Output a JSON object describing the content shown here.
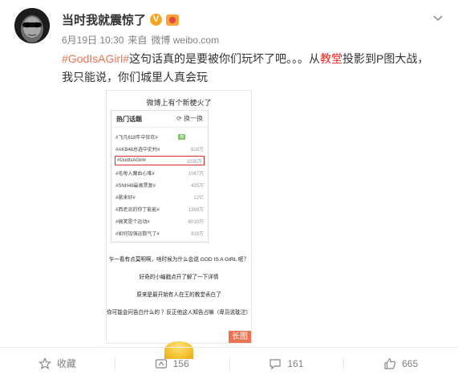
{
  "post": {
    "author": "当时我就震惊了",
    "meta": {
      "time": "6月19日 10:30",
      "from": "来自",
      "source": "微博 weibo.com"
    },
    "text": {
      "hashtag": "#GodIsAGirl#",
      "part1": "这句话真的是要被你们玩坏了吧。。。从",
      "keyword": "教堂",
      "part2": "投影到P图大战，我只能说，你们城里人真会玩"
    }
  },
  "long_image": {
    "caption": "微博上有个新梗火了",
    "panel": {
      "title": "热门话题",
      "refresh": "换一换",
      "rows": [
        {
          "name": "#飞凡618年中狂欢#",
          "count": "",
          "badge": "荐"
        },
        {
          "name": "#AKB48总选中史村#",
          "count": "628万",
          "badge": ""
        },
        {
          "name": "#GodIsAGirl#",
          "count": "1039万",
          "badge": ""
        },
        {
          "name": "#毛每入魔血心难#",
          "count": "1067万",
          "badge": ""
        },
        {
          "name": "#SNH48最高票复#",
          "count": "425万",
          "badge": ""
        },
        {
          "name": "#歌来好#",
          "count": "12亿",
          "badge": ""
        },
        {
          "name": "#西老派的你丁能能#",
          "count": "1369万",
          "badge": ""
        },
        {
          "name": "#搞笑是个运动#",
          "count": "8019万",
          "badge": ""
        },
        {
          "name": "#如何加强运数气了#",
          "count": "818万",
          "badge": ""
        }
      ]
    },
    "lines": [
      "乍一看有点莫明啊，啥时候为什么会说 GOD IS A GIRL 呢？",
      "好奇的小编戳点开了解了一下详情",
      "原来是最开始有人在王的教堂表白了",
      "你可能会问告白什么的 ？反正他这人知告占嘛（卑员说耽注）"
    ],
    "long_label": "长图"
  },
  "actions": {
    "favorite": "收藏",
    "forward": "156",
    "comment": "161",
    "like": "665"
  },
  "colors": {
    "link": "#eb7350",
    "keyword": "#e0271b",
    "highlight_border": "#d9302a"
  }
}
